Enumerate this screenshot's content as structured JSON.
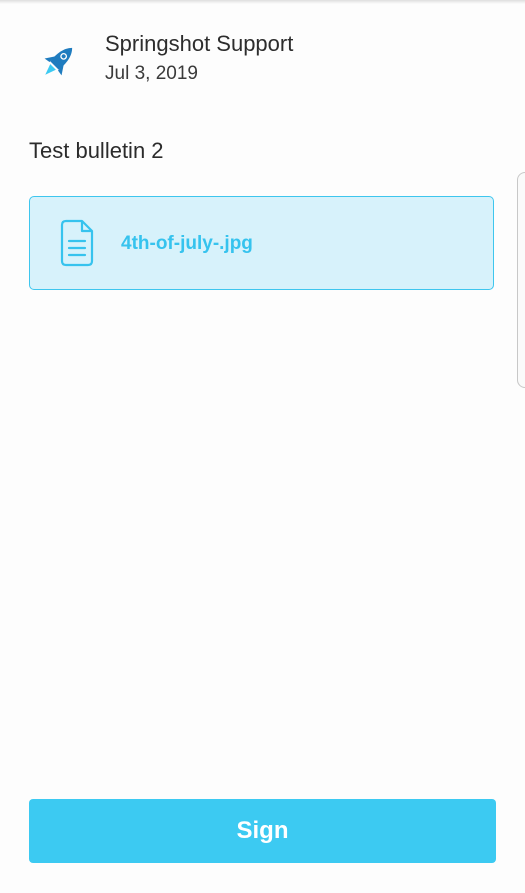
{
  "header": {
    "sender": "Springshot Support",
    "date": "Jul 3, 2019",
    "avatar_icon": "rocket-icon"
  },
  "bulletin": {
    "title": "Test bulletin 2",
    "attachment": {
      "file_name": "4th-of-july-.jpg",
      "icon": "document-icon"
    }
  },
  "actions": {
    "sign_label": "Sign"
  },
  "colors": {
    "accent": "#3ccaf2",
    "attachment_bg": "#d7f2fb",
    "attachment_border": "#3ec6ee",
    "rocket": "#1f7cbf"
  }
}
